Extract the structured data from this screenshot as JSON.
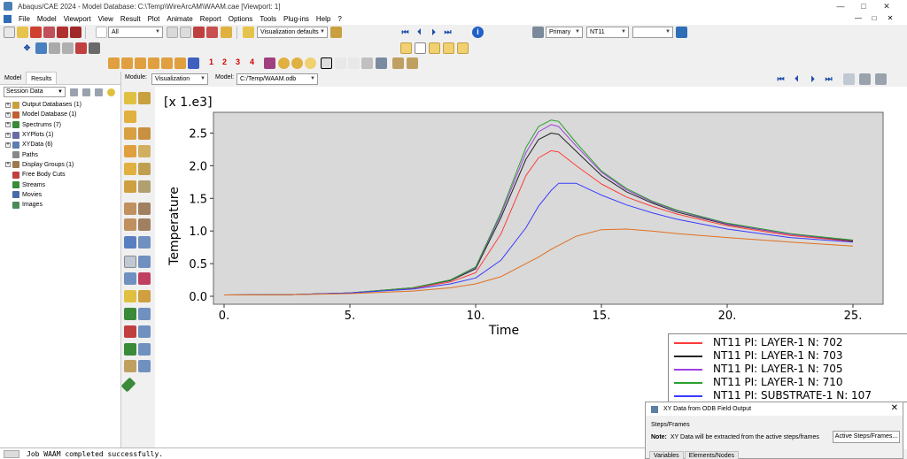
{
  "window": {
    "title": "Abaqus/CAE 2024 - Model Database: C:\\Temp\\WireArcAM\\WAAM.cae [Viewport: 1]",
    "controls": [
      "—",
      "□",
      "✕"
    ]
  },
  "menu": {
    "items": [
      "File",
      "Model",
      "Viewport",
      "View",
      "Result",
      "Plot",
      "Animate",
      "Report",
      "Options",
      "Tools",
      "Plug-ins",
      "Help",
      "?"
    ],
    "window_controls": [
      "—",
      "□",
      "✕"
    ]
  },
  "toolbar": {
    "selection_filter": "All",
    "visualization_defaults": "Visualization defaults",
    "field_output_primary": "Primary",
    "field_output_variable": "NT11",
    "field_output_component": "",
    "view_numbers": [
      "1",
      "2",
      "3",
      "4"
    ]
  },
  "module_row": {
    "module_label": "Module:",
    "module_value": "Visualization",
    "model_label": "Model:",
    "model_value": "C:/Temp/WAAM.odb"
  },
  "left_panel": {
    "tabs": [
      "Model",
      "Results"
    ],
    "active_tab": "Results",
    "session_combo": "Session Data",
    "tree": [
      {
        "label": "Output Databases (1)",
        "expandable": true,
        "color": "#c8a040"
      },
      {
        "label": "Model Database (1)",
        "expandable": true,
        "color": "#c06030"
      },
      {
        "label": "Spectrums (7)",
        "expandable": true,
        "color": "#3a8a3a"
      },
      {
        "label": "XYPlots (1)",
        "expandable": true,
        "color": "#6a6aa8"
      },
      {
        "label": "XYData (6)",
        "expandable": true,
        "color": "#5a7fb0"
      },
      {
        "label": "Paths",
        "expandable": false,
        "color": "#888888"
      },
      {
        "label": "Display Groups (1)",
        "expandable": true,
        "color": "#9a7a50"
      },
      {
        "label": "Free Body Cuts",
        "expandable": false,
        "color": "#c04040"
      },
      {
        "label": "Streams",
        "expandable": false,
        "color": "#3a8a3a"
      },
      {
        "label": "Movies",
        "expandable": false,
        "color": "#4a6aa8"
      },
      {
        "label": "Images",
        "expandable": false,
        "color": "#4a8a5a"
      }
    ]
  },
  "chart_data": {
    "type": "line",
    "title": "",
    "xlabel": "Time",
    "ylabel": "Temperature",
    "y_multiplier_label": "[x 1.e3]",
    "xlim": [
      0,
      25
    ],
    "ylim": [
      0,
      2.75
    ],
    "x_ticks": [
      "0.",
      "5.",
      "10.",
      "15.",
      "20.",
      "25."
    ],
    "y_ticks": [
      "0.0",
      "0.5",
      "1.0",
      "1.5",
      "2.0",
      "2.5"
    ],
    "grid": false,
    "legend_position": "bottom-right",
    "x": [
      0,
      2.5,
      5,
      7.5,
      9,
      10,
      11,
      12,
      12.5,
      13,
      13.3,
      14,
      15,
      16,
      17,
      18,
      20,
      22.5,
      25
    ],
    "series": [
      {
        "name": "NT11 PI: LAYER-1 N: 702",
        "color": "#ff3b3b",
        "values": [
          0.02,
          0.025,
          0.05,
          0.12,
          0.22,
          0.36,
          0.95,
          1.85,
          2.12,
          2.23,
          2.21,
          2.0,
          1.72,
          1.52,
          1.38,
          1.26,
          1.08,
          0.93,
          0.84
        ]
      },
      {
        "name": "NT11 PI: LAYER-1 N: 703",
        "color": "#222222",
        "values": [
          0.02,
          0.025,
          0.05,
          0.13,
          0.24,
          0.42,
          1.2,
          2.1,
          2.4,
          2.5,
          2.48,
          2.22,
          1.85,
          1.6,
          1.43,
          1.29,
          1.1,
          0.95,
          0.85
        ]
      },
      {
        "name": "NT11 PI: LAYER-1 N: 705",
        "color": "#a040e0",
        "values": [
          0.02,
          0.025,
          0.05,
          0.13,
          0.25,
          0.44,
          1.25,
          2.2,
          2.52,
          2.63,
          2.6,
          2.3,
          1.9,
          1.63,
          1.45,
          1.31,
          1.11,
          0.95,
          0.86
        ]
      },
      {
        "name": "NT11 PI: LAYER-1 N: 710",
        "color": "#2ca02c",
        "values": [
          0.02,
          0.025,
          0.05,
          0.13,
          0.25,
          0.45,
          1.28,
          2.28,
          2.6,
          2.7,
          2.68,
          2.35,
          1.92,
          1.65,
          1.46,
          1.32,
          1.12,
          0.96,
          0.86
        ]
      },
      {
        "name": "NT11 PI: SUBSTRATE-1 N: 107",
        "color": "#3a3aff",
        "values": [
          0.02,
          0.025,
          0.05,
          0.11,
          0.19,
          0.28,
          0.55,
          1.05,
          1.38,
          1.62,
          1.73,
          1.73,
          1.55,
          1.4,
          1.28,
          1.18,
          1.03,
          0.9,
          0.83
        ]
      },
      {
        "name": "",
        "color": "#e07020",
        "values": [
          0.02,
          0.025,
          0.04,
          0.08,
          0.13,
          0.19,
          0.3,
          0.5,
          0.6,
          0.72,
          0.78,
          0.92,
          1.02,
          1.03,
          1.0,
          0.96,
          0.9,
          0.83,
          0.77
        ]
      }
    ]
  },
  "legend": {
    "entries": [
      {
        "label": "NT11 PI: LAYER-1 N: 702",
        "color": "#ff3b3b"
      },
      {
        "label": "NT11 PI: LAYER-1 N: 703",
        "color": "#222222"
      },
      {
        "label": "NT11 PI: LAYER-1 N: 705",
        "color": "#a040e0"
      },
      {
        "label": "NT11 PI: LAYER-1 N: 710",
        "color": "#2ca02c"
      },
      {
        "label": "NT11 PI: SUBSTRATE-1 N: 107",
        "color": "#3a3aff"
      }
    ]
  },
  "dialog": {
    "title": "XY Data from ODB Field Output",
    "section": "Steps/Frames",
    "note_label": "Note:",
    "note_text": "XY Data will be extracted from the active steps/frames",
    "button": "Active Steps/Frames...",
    "tabs": [
      "Variables",
      "Elements/Nodes"
    ]
  },
  "message": {
    "text": "Job WAAM completed successfully."
  }
}
